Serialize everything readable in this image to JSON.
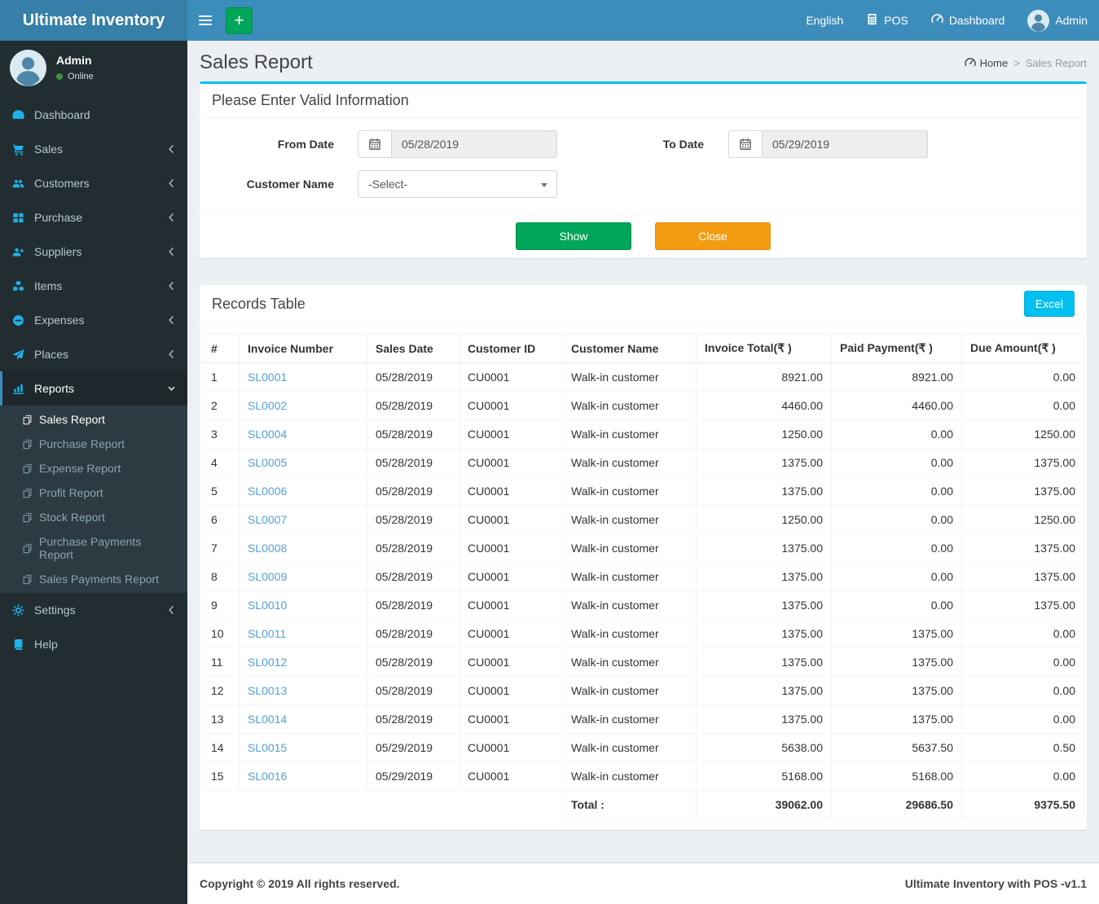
{
  "app": {
    "title": "Ultimate Inventory",
    "copyright": "Copyright © 2019 All rights reserved.",
    "version_text": "Ultimate Inventory with POS -v1.1"
  },
  "navbar": {
    "language_label": "English",
    "pos_label": "POS",
    "dashboard_label": "Dashboard",
    "user_label": "Admin"
  },
  "sidebar": {
    "user": {
      "name": "Admin",
      "status": "Online"
    },
    "items": [
      {
        "label": "Dashboard",
        "icon": "tachometer-icon"
      },
      {
        "label": "Sales",
        "icon": "cart-icon",
        "chevron": "left"
      },
      {
        "label": "Customers",
        "icon": "users-icon",
        "chevron": "left"
      },
      {
        "label": "Purchase",
        "icon": "grid-icon",
        "chevron": "left"
      },
      {
        "label": "Suppliers",
        "icon": "user-plus-icon",
        "chevron": "left"
      },
      {
        "label": "Items",
        "icon": "cubes-icon",
        "chevron": "left"
      },
      {
        "label": "Expenses",
        "icon": "minus-circle-icon",
        "chevron": "left"
      },
      {
        "label": "Places",
        "icon": "paper-plane-icon",
        "chevron": "left"
      },
      {
        "label": "Reports",
        "icon": "bar-chart-icon",
        "chevron": "down",
        "active": true
      },
      {
        "label": "Settings",
        "icon": "gears-icon",
        "chevron": "left"
      },
      {
        "label": "Help",
        "icon": "book-icon"
      }
    ],
    "reports_submenu": [
      {
        "label": "Sales Report",
        "active": true
      },
      {
        "label": "Purchase Report"
      },
      {
        "label": "Expense Report"
      },
      {
        "label": "Profit Report"
      },
      {
        "label": "Stock Report"
      },
      {
        "label": "Purchase Payments Report"
      },
      {
        "label": "Sales Payments Report"
      }
    ]
  },
  "page": {
    "title": "Sales Report",
    "breadcrumb": {
      "home": "Home",
      "separator": ">",
      "current": "Sales Report"
    }
  },
  "filter": {
    "panel_title": "Please Enter Valid Information",
    "from_date": {
      "label": "From Date",
      "value": "05/28/2019"
    },
    "to_date": {
      "label": "To Date",
      "value": "05/29/2019"
    },
    "customer": {
      "label": "Customer Name",
      "value": "-Select-"
    },
    "show_label": "Show",
    "close_label": "Close"
  },
  "records": {
    "panel_title": "Records Table",
    "excel_label": "Excel",
    "columns": [
      "#",
      "Invoice Number",
      "Sales Date",
      "Customer ID",
      "Customer Name",
      "Invoice Total(₹ )",
      "Paid Payment(₹ )",
      "Due Amount(₹ )"
    ],
    "rows": [
      {
        "n": "1",
        "invoice": "SL0001",
        "date": "05/28/2019",
        "customer_id": "CU0001",
        "customer_name": "Walk-in customer",
        "invoice_total": "8921.00",
        "paid_payment": "8921.00",
        "due_amount": "0.00"
      },
      {
        "n": "2",
        "invoice": "SL0002",
        "date": "05/28/2019",
        "customer_id": "CU0001",
        "customer_name": "Walk-in customer",
        "invoice_total": "4460.00",
        "paid_payment": "4460.00",
        "due_amount": "0.00"
      },
      {
        "n": "3",
        "invoice": "SL0004",
        "date": "05/28/2019",
        "customer_id": "CU0001",
        "customer_name": "Walk-in customer",
        "invoice_total": "1250.00",
        "paid_payment": "0.00",
        "due_amount": "1250.00"
      },
      {
        "n": "4",
        "invoice": "SL0005",
        "date": "05/28/2019",
        "customer_id": "CU0001",
        "customer_name": "Walk-in customer",
        "invoice_total": "1375.00",
        "paid_payment": "0.00",
        "due_amount": "1375.00"
      },
      {
        "n": "5",
        "invoice": "SL0006",
        "date": "05/28/2019",
        "customer_id": "CU0001",
        "customer_name": "Walk-in customer",
        "invoice_total": "1375.00",
        "paid_payment": "0.00",
        "due_amount": "1375.00"
      },
      {
        "n": "6",
        "invoice": "SL0007",
        "date": "05/28/2019",
        "customer_id": "CU0001",
        "customer_name": "Walk-in customer",
        "invoice_total": "1250.00",
        "paid_payment": "0.00",
        "due_amount": "1250.00"
      },
      {
        "n": "7",
        "invoice": "SL0008",
        "date": "05/28/2019",
        "customer_id": "CU0001",
        "customer_name": "Walk-in customer",
        "invoice_total": "1375.00",
        "paid_payment": "0.00",
        "due_amount": "1375.00"
      },
      {
        "n": "8",
        "invoice": "SL0009",
        "date": "05/28/2019",
        "customer_id": "CU0001",
        "customer_name": "Walk-in customer",
        "invoice_total": "1375.00",
        "paid_payment": "0.00",
        "due_amount": "1375.00"
      },
      {
        "n": "9",
        "invoice": "SL0010",
        "date": "05/28/2019",
        "customer_id": "CU0001",
        "customer_name": "Walk-in customer",
        "invoice_total": "1375.00",
        "paid_payment": "0.00",
        "due_amount": "1375.00"
      },
      {
        "n": "10",
        "invoice": "SL0011",
        "date": "05/28/2019",
        "customer_id": "CU0001",
        "customer_name": "Walk-in customer",
        "invoice_total": "1375.00",
        "paid_payment": "1375.00",
        "due_amount": "0.00"
      },
      {
        "n": "11",
        "invoice": "SL0012",
        "date": "05/28/2019",
        "customer_id": "CU0001",
        "customer_name": "Walk-in customer",
        "invoice_total": "1375.00",
        "paid_payment": "1375.00",
        "due_amount": "0.00"
      },
      {
        "n": "12",
        "invoice": "SL0013",
        "date": "05/28/2019",
        "customer_id": "CU0001",
        "customer_name": "Walk-in customer",
        "invoice_total": "1375.00",
        "paid_payment": "1375.00",
        "due_amount": "0.00"
      },
      {
        "n": "13",
        "invoice": "SL0014",
        "date": "05/28/2019",
        "customer_id": "CU0001",
        "customer_name": "Walk-in customer",
        "invoice_total": "1375.00",
        "paid_payment": "1375.00",
        "due_amount": "0.00"
      },
      {
        "n": "14",
        "invoice": "SL0015",
        "date": "05/29/2019",
        "customer_id": "CU0001",
        "customer_name": "Walk-in customer",
        "invoice_total": "5638.00",
        "paid_payment": "5637.50",
        "due_amount": "0.50"
      },
      {
        "n": "15",
        "invoice": "SL0016",
        "date": "05/29/2019",
        "customer_id": "CU0001",
        "customer_name": "Walk-in customer",
        "invoice_total": "5168.00",
        "paid_payment": "5168.00",
        "due_amount": "0.00"
      }
    ],
    "total": {
      "label": "Total :",
      "invoice_total": "39062.00",
      "paid_payment": "29686.50",
      "due_amount": "9375.50"
    }
  },
  "colors": {
    "navbar": "#3c8dbc",
    "logo_bg": "#367fa9",
    "sidebar_bg": "#222d32",
    "submenu_bg": "#2c3b41",
    "accent_cyan": "#00c0ef",
    "green": "#00a65a",
    "orange": "#f39c12",
    "link_blue": "#54a0d6",
    "sidebar_icon_blue": "#1eb2ea",
    "online_green": "#3c923c"
  }
}
